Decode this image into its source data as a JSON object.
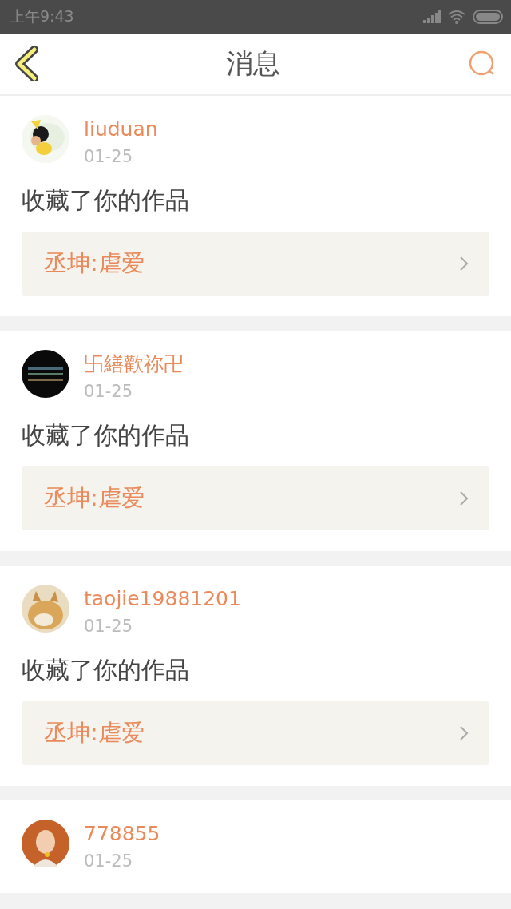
{
  "status_bar": {
    "time": "上午9:43"
  },
  "header": {
    "title": "消息"
  },
  "messages": [
    {
      "name": "liuduan",
      "date": "01-25",
      "action": "收藏了你的作品",
      "work": "丞坤:虐爱"
    },
    {
      "name": "卐繕歡祢卍",
      "date": "01-25",
      "action": "收藏了你的作品",
      "work": "丞坤:虐爱"
    },
    {
      "name": "taojie19881201",
      "date": "01-25",
      "action": "收藏了你的作品",
      "work": "丞坤:虐爱"
    },
    {
      "name": "778855",
      "date": "01-25"
    }
  ]
}
